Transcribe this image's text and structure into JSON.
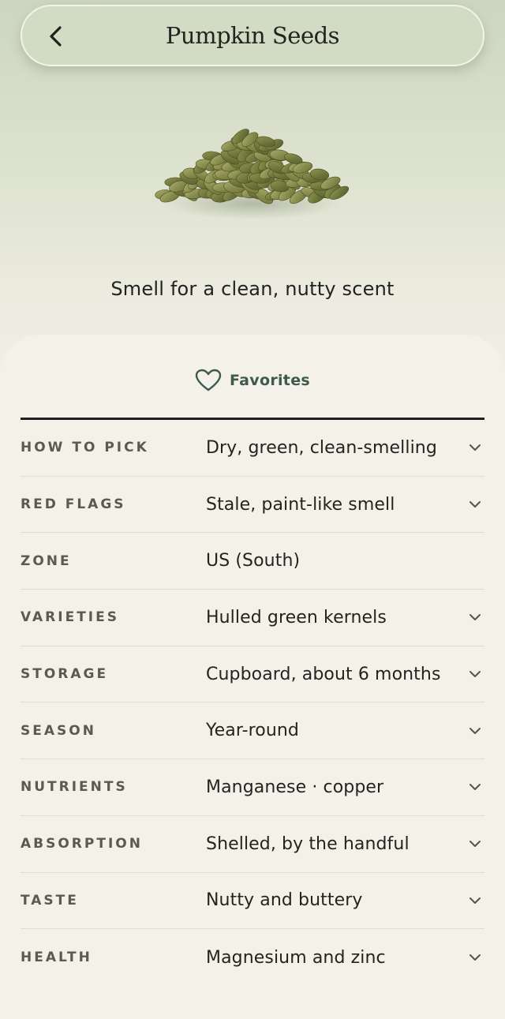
{
  "header": {
    "title": "Pumpkin Seeds"
  },
  "hero": {
    "image_icon": "pumpkin-seeds-pile-image",
    "tagline": "Smell for a clean, nutty scent"
  },
  "favorites": {
    "label": "Favorites",
    "icon": "heart-outline-icon"
  },
  "colors": {
    "accent": "#3d5a4d",
    "hero_bg": "#ccd6c0",
    "sheet_bg": "#f4f1e8"
  },
  "details": [
    {
      "key": "HOW TO PICK",
      "value": "Dry, green, clean-smelling",
      "expandable": true
    },
    {
      "key": "RED FLAGS",
      "value": "Stale, paint-like smell",
      "expandable": true
    },
    {
      "key": "ZONE",
      "value": "US (South)",
      "expandable": false
    },
    {
      "key": "VARIETIES",
      "value": "Hulled green kernels",
      "expandable": true
    },
    {
      "key": "STORAGE",
      "value": "Cupboard, about 6 months",
      "expandable": true
    },
    {
      "key": "SEASON",
      "value": "Year-round",
      "expandable": true
    },
    {
      "key": "NUTRIENTS",
      "value": "Manganese · copper",
      "expandable": true
    },
    {
      "key": "ABSORPTION",
      "value": "Shelled, by the handful",
      "expandable": true
    },
    {
      "key": "TASTE",
      "value": "Nutty and buttery",
      "expandable": true
    },
    {
      "key": "HEALTH",
      "value": "Magnesium and zinc",
      "expandable": true
    }
  ]
}
